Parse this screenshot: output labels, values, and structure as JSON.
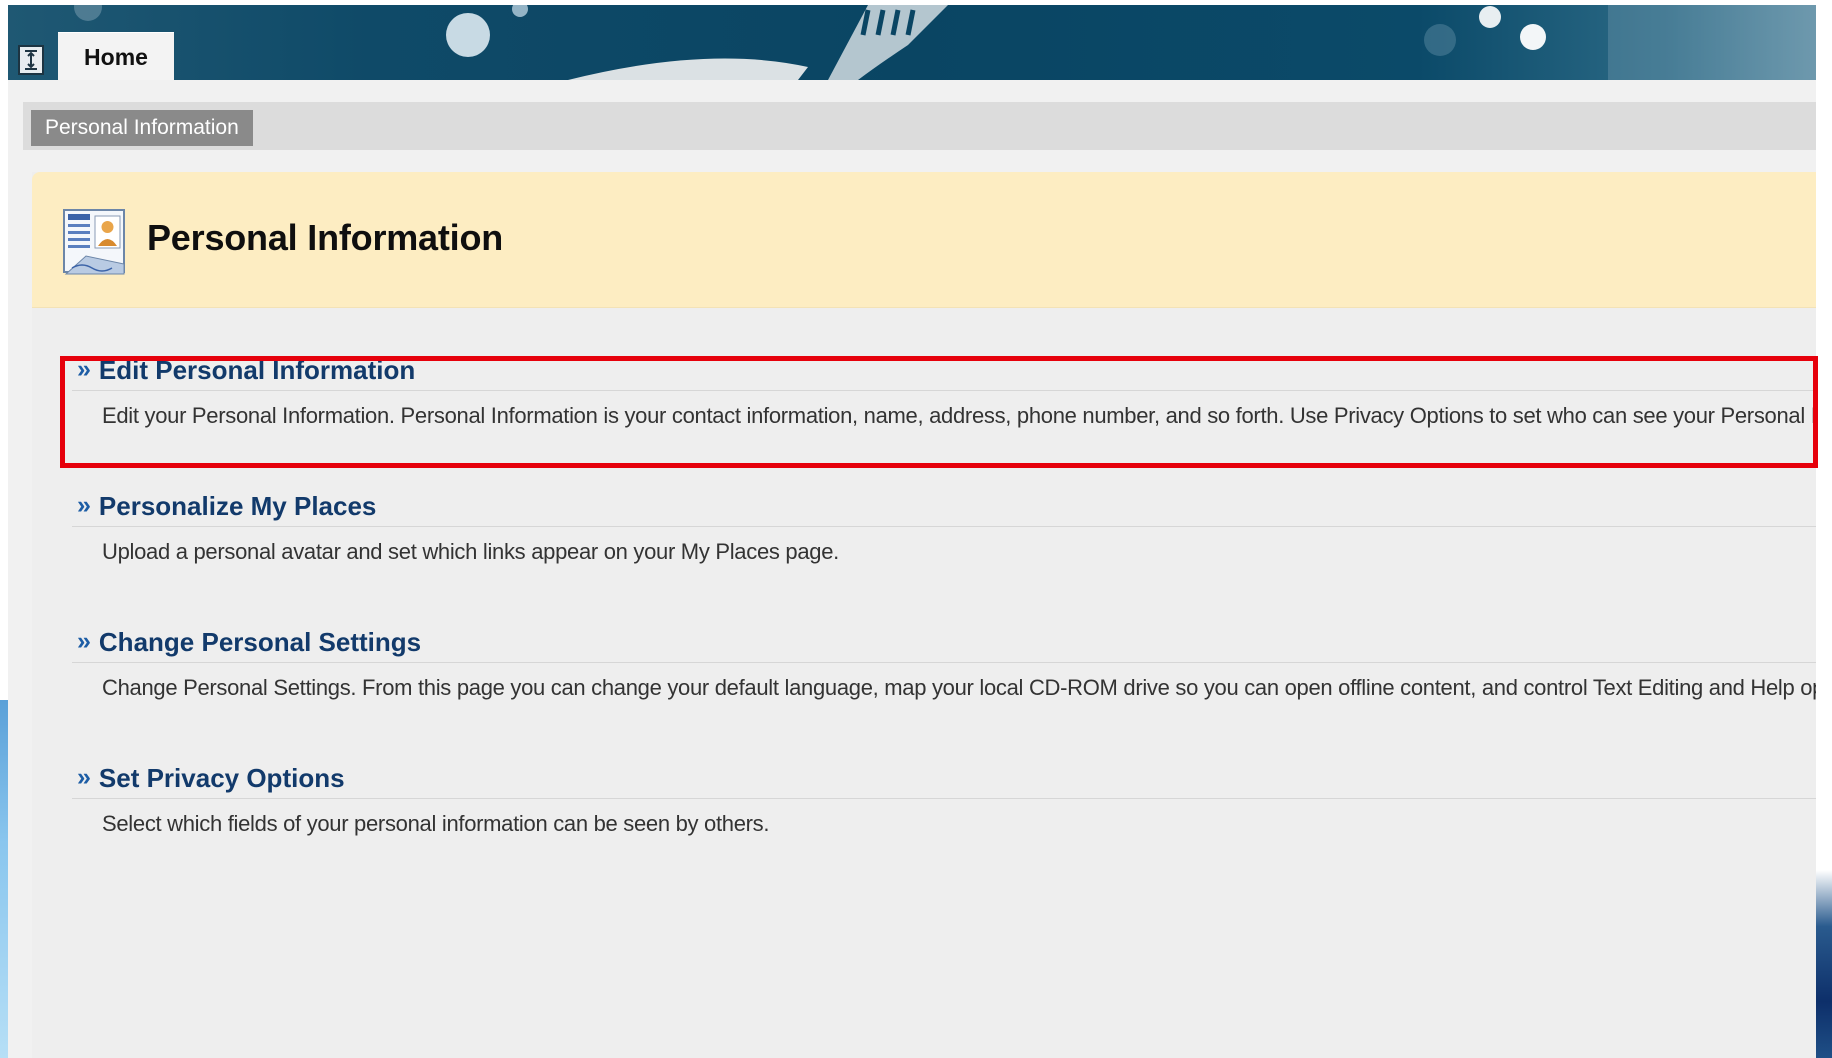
{
  "nav": {
    "home_tab": "Home"
  },
  "breadcrumb": {
    "current": "Personal Information"
  },
  "page": {
    "title": "Personal Information"
  },
  "tasks": [
    {
      "title": "Edit Personal Information",
      "description": "Edit your Personal Information. Personal Information is your contact information, name, address, phone number, and so forth. Use Privacy Options to set who can see your Personal Information."
    },
    {
      "title": "Personalize My Places",
      "description": "Upload a personal avatar and set which links appear on your My Places page."
    },
    {
      "title": "Change Personal Settings",
      "description": "Change Personal Settings. From this page you can change your default language, map your local CD-ROM drive so you can open offline content, and control Text Editing and Help options."
    },
    {
      "title": "Set Privacy Options",
      "description": "Select which fields of your personal information can be seen by others."
    }
  ],
  "theme": {
    "link_color": "#123a6b",
    "header_bg": "#fdedc2",
    "highlight_color": "#e6000b"
  }
}
